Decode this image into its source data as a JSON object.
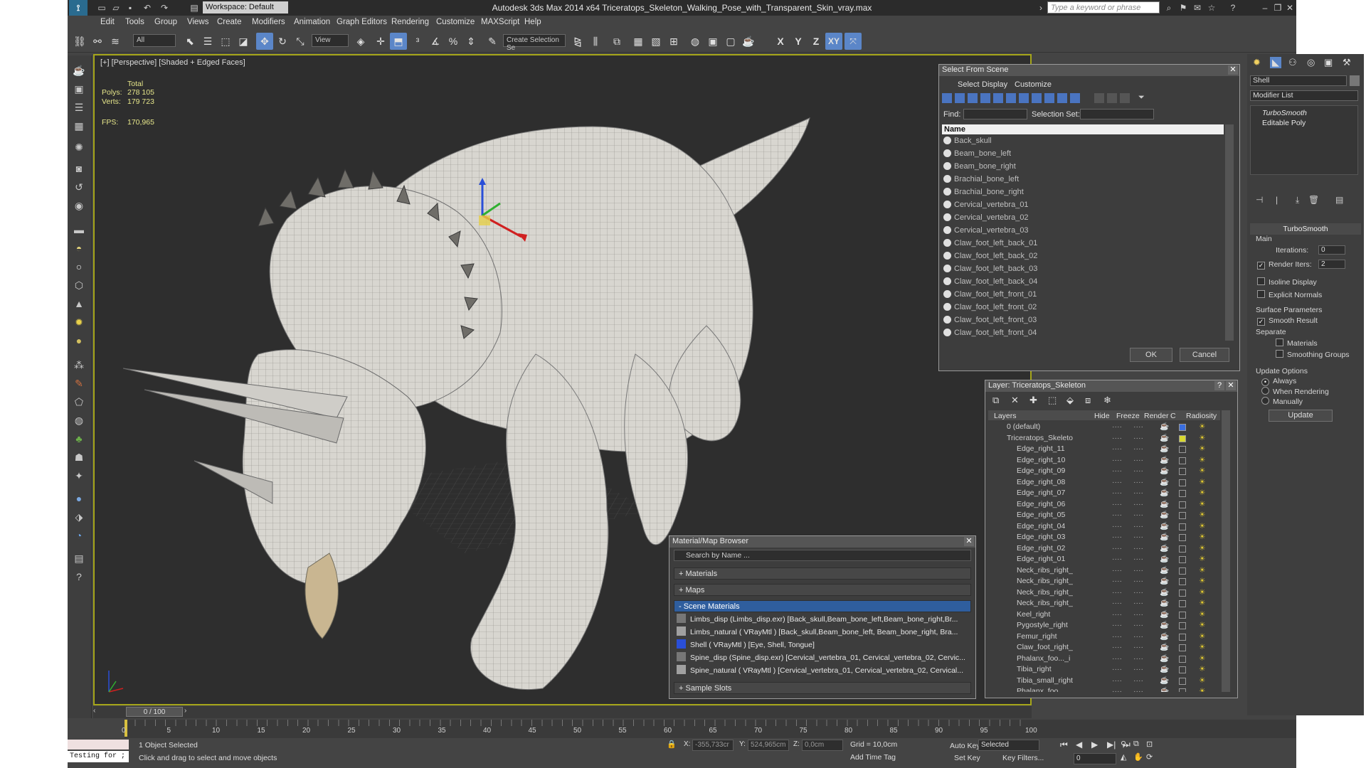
{
  "window": {
    "title": "Autodesk 3ds Max 2014 x64    Triceratops_Skeleton_Walking_Pose_with_Transparent_Skin_vray.max",
    "workspace": "Workspace: Default",
    "search_placeholder": "Type a keyword or phrase"
  },
  "menu": [
    "Edit",
    "Tools",
    "Group",
    "Views",
    "Create",
    "Modifiers",
    "Animation",
    "Graph Editors",
    "Rendering",
    "Customize",
    "MAXScript",
    "Help"
  ],
  "toolbar": {
    "selection_filter": "All",
    "ref_coord": "View",
    "named_selection": "Create Selection Se",
    "axis_x": "X",
    "axis_y": "Y",
    "axis_z": "Z",
    "axis_xy": "XY"
  },
  "viewport": {
    "label": "[+] [Perspective] [Shaded + Edged Faces]",
    "stats_total": "Total",
    "polys_label": "Polys:",
    "polys_value": "278 105",
    "verts_label": "Verts:",
    "verts_value": "179 723",
    "fps_label": "FPS:",
    "fps_value": "170,965"
  },
  "select_from_scene": {
    "title": "Select From Scene",
    "tabs": [
      "Select",
      "Display",
      "Customize"
    ],
    "find_label": "Find:",
    "selection_set_label": "Selection Set:",
    "column": "Name",
    "items": [
      "Back_skull",
      "Beam_bone_left",
      "Beam_bone_right",
      "Brachial_bone_left",
      "Brachial_bone_right",
      "Cervical_vertebra_01",
      "Cervical_vertebra_02",
      "Cervical_vertebra_03",
      "Claw_foot_left_back_01",
      "Claw_foot_left_back_02",
      "Claw_foot_left_back_03",
      "Claw_foot_left_back_04",
      "Claw_foot_left_front_01",
      "Claw_foot_left_front_02",
      "Claw_foot_left_front_03",
      "Claw_foot_left_front_04"
    ],
    "ok": "OK",
    "cancel": "Cancel"
  },
  "layer_dialog": {
    "title": "Layer: Triceratops_Skeleton",
    "columns": [
      "Layers",
      "Hide",
      "Freeze",
      "Render",
      "C",
      "Radiosity"
    ],
    "rows": [
      "0 (default)",
      "Triceratops_Skeleto",
      "Edge_right_11",
      "Edge_right_10",
      "Edge_right_09",
      "Edge_right_08",
      "Edge_right_07",
      "Edge_right_06",
      "Edge_right_05",
      "Edge_right_04",
      "Edge_right_03",
      "Edge_right_02",
      "Edge_right_01",
      "Neck_ribs_right_",
      "Neck_ribs_right_",
      "Neck_ribs_right_",
      "Neck_ribs_right_",
      "Keel_right",
      "Pygostyle_right",
      "Femur_right",
      "Claw_foot_right_",
      "Phalanx_foo..._i",
      "Tibia_right",
      "Tibia_small_right",
      "Phalanx_foo"
    ]
  },
  "material_browser": {
    "title": "Material/Map Browser",
    "search_placeholder": "Search by Name ...",
    "sections": [
      "+ Materials",
      "+ Maps",
      "- Scene Materials",
      "+ Sample Slots"
    ],
    "scene_materials": [
      "Limbs_disp (Limbs_disp.exr) [Back_skull,Beam_bone_left,Beam_bone_right,Br...",
      "Limbs_natural  ( VRayMtl ) [Back_skull,Beam_bone_left, Beam_bone_right, Bra...",
      "Shell  ( VRayMtl ) [Eye, Shell, Tongue]",
      "Spine_disp (Spine_disp.exr) [Cervical_vertebra_01, Cervical_vertebra_02, Cervic...",
      "Spine_natural  ( VRayMtl ) [Cervical_vertebra_01, Cervical_vertebra_02, Cervical..."
    ]
  },
  "modifier_panel": {
    "object_name": "Shell",
    "modifier_list": "Modifier List",
    "stack": [
      "TurboSmooth",
      "Editable Poly"
    ],
    "rollout": "TurboSmooth",
    "main_group": "Main",
    "iterations_label": "Iterations:",
    "iterations_value": "0",
    "render_iters_label": "Render Iters:",
    "render_iters_value": "2",
    "isoline": "Isoline Display",
    "explicit_normals": "Explicit Normals",
    "surface_params": "Surface Parameters",
    "smooth_result": "Smooth Result",
    "separate": "Separate",
    "materials": "Materials",
    "smoothing_groups": "Smoothing Groups",
    "update_options": "Update Options",
    "always": "Always",
    "when_rendering": "When Rendering",
    "manually": "Manually",
    "update": "Update"
  },
  "timeline": {
    "frame": "0 / 100",
    "ticks": [
      "0",
      "5",
      "10",
      "15",
      "20",
      "25",
      "30",
      "35",
      "40",
      "45",
      "50",
      "55",
      "60",
      "65",
      "70",
      "75",
      "80",
      "85",
      "90",
      "95",
      "100"
    ]
  },
  "status": {
    "maxscript": "Testing for ;",
    "selected": "1 Object Selected",
    "prompt": "Click and drag to select and move objects",
    "x_label": "X:",
    "x_value": "-355,733cr",
    "y_label": "Y:",
    "y_value": "524,965cm",
    "z_label": "Z:",
    "z_value": "0,0cm",
    "grid": "Grid = 10,0cm",
    "add_time_tag": "Add Time Tag",
    "auto_key": "Auto Key",
    "set_key": "Set Key",
    "key_mode": "Selected",
    "key_filters": "Key Filters...",
    "frame_field": "0"
  }
}
